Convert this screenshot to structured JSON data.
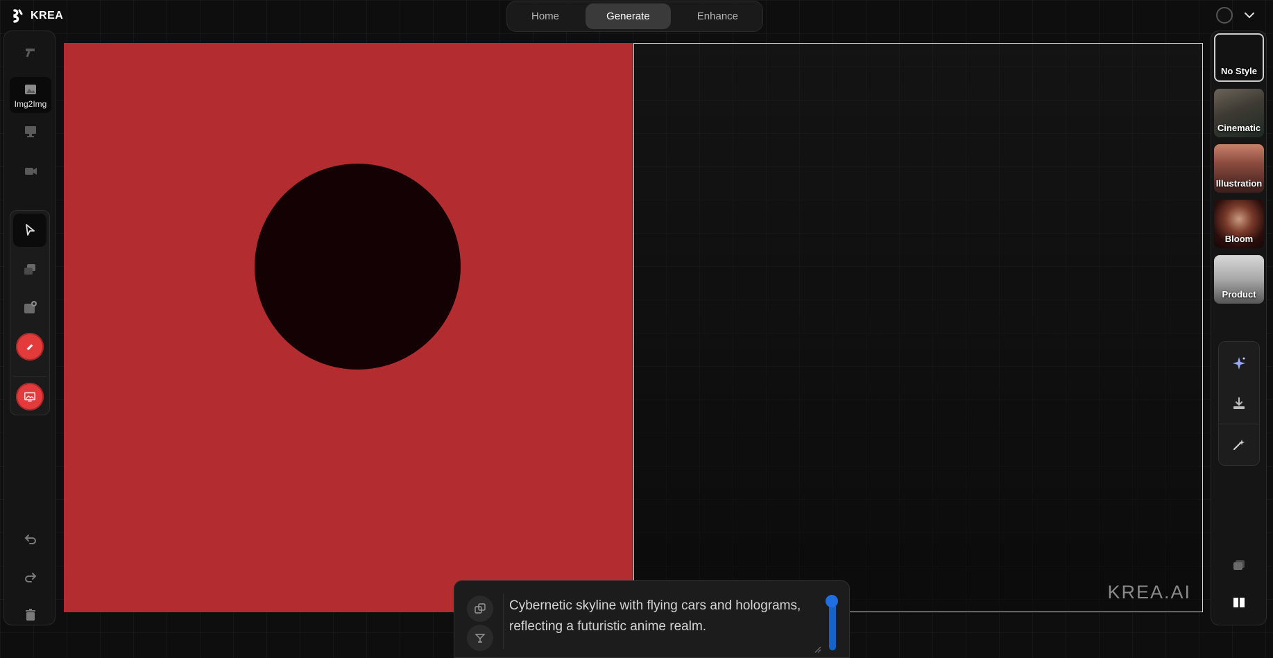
{
  "brand": {
    "name": "KREA",
    "logo_icon": "krea-logo-icon"
  },
  "nav": {
    "tabs": [
      {
        "label": "Home",
        "active": false
      },
      {
        "label": "Generate",
        "active": true
      },
      {
        "label": "Enhance",
        "active": false
      }
    ]
  },
  "left_sidebar": {
    "modes": [
      {
        "icon": "magic-wand-icon",
        "label": "",
        "active": false
      },
      {
        "icon": "image-icon",
        "label": "Img2Img",
        "active": true
      },
      {
        "icon": "monitor-icon",
        "label": "",
        "active": false
      },
      {
        "icon": "video-camera-icon",
        "label": "",
        "active": false
      }
    ],
    "tools": [
      {
        "icon": "cursor-arrow-icon",
        "active": true
      },
      {
        "icon": "layers-icon",
        "active": false
      },
      {
        "icon": "add-image-icon",
        "active": false
      },
      {
        "icon": "eraser-icon",
        "active": false,
        "color": "#e33b3b"
      },
      {
        "icon": "screen-capture-icon",
        "active": false,
        "color": "#e33b3b"
      }
    ],
    "history": [
      {
        "icon": "undo-icon"
      },
      {
        "icon": "redo-icon"
      },
      {
        "icon": "trash-icon"
      }
    ]
  },
  "canvas": {
    "background_color": "#b32d30",
    "shape_color": "#130103"
  },
  "output": {
    "watermark": "KREA.AI"
  },
  "prompt": {
    "text": "Cybernetic skyline with flying cars and holograms, reflecting a futuristic anime realm.",
    "buttons": [
      {
        "icon": "shuffle-dice-icon"
      },
      {
        "icon": "cocktail-glass-icon"
      }
    ],
    "accent_color": "#1762c8"
  },
  "styles": [
    {
      "label": "No Style",
      "selected": true
    },
    {
      "label": "Cinematic",
      "selected": false
    },
    {
      "label": "Illustration",
      "selected": false
    },
    {
      "label": "Bloom",
      "selected": false
    },
    {
      "label": "Product",
      "selected": false
    }
  ],
  "right_actions": [
    {
      "icon": "sparkles-icon"
    },
    {
      "icon": "download-icon"
    },
    {
      "icon": "enhance-sparkle-icon"
    }
  ],
  "right_bottom": [
    {
      "icon": "stack-icon"
    },
    {
      "icon": "split-view-icon"
    }
  ]
}
